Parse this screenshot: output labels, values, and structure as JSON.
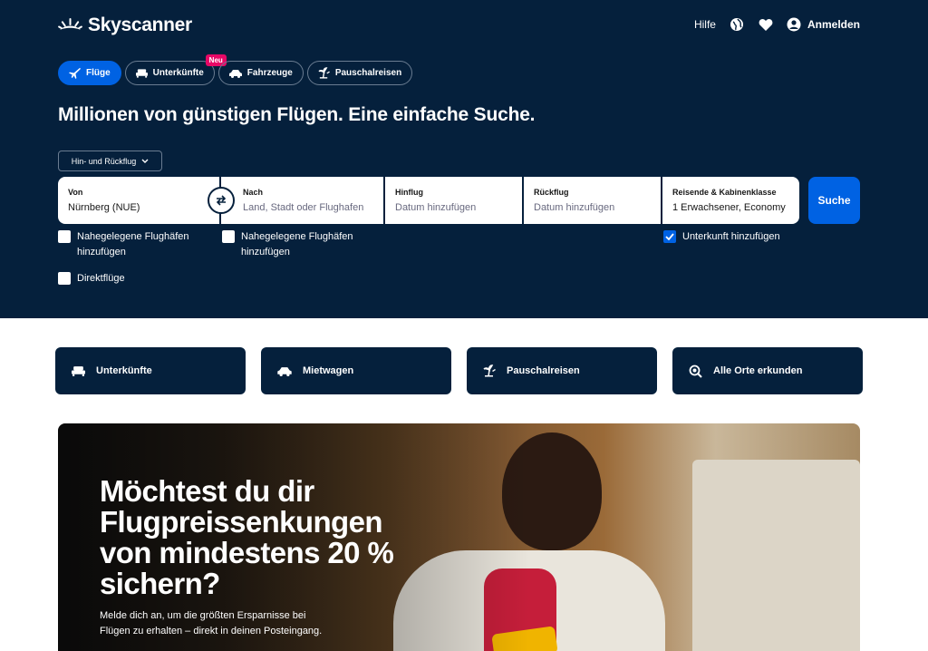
{
  "header": {
    "logo_text": "Skyscanner",
    "help_label": "Hilfe",
    "login_label": "Anmelden"
  },
  "tabs": [
    {
      "label": "Flüge",
      "icon": "plane-icon",
      "active": true
    },
    {
      "label": "Unterkünfte",
      "icon": "bed-icon",
      "badge": "Neu"
    },
    {
      "label": "Fahrzeuge",
      "icon": "car-icon"
    },
    {
      "label": "Pauschalreisen",
      "icon": "palm-plane-icon"
    }
  ],
  "headline": "Millionen von günstigen Flügen. Eine einfache Suche.",
  "trip_type": "Hin- und Rückflug",
  "search": {
    "from_label": "Von",
    "from_value": "Nürnberg (NUE)",
    "to_label": "Nach",
    "to_placeholder": "Land, Stadt oder Flughafen",
    "depart_label": "Hinflug",
    "depart_placeholder": "Datum hinzufügen",
    "return_label": "Rückflug",
    "return_placeholder": "Datum hinzufügen",
    "pax_label": "Reisende & Kabinenklasse",
    "pax_value": "1 Erwachsener, Economy",
    "search_button": "Suche"
  },
  "checkboxes": {
    "nearby_from": "Nahegelegene Flughäfen hinzufügen",
    "nearby_to": "Nahegelegene Flughäfen hinzufügen",
    "direct": "Direktflüge",
    "add_hotel": "Unterkunft hinzufügen"
  },
  "quicklinks": [
    {
      "label": "Unterkünfte",
      "icon": "bed-icon"
    },
    {
      "label": "Mietwagen",
      "icon": "car-icon"
    },
    {
      "label": "Pauschalreisen",
      "icon": "palm-plane-icon"
    },
    {
      "label": "Alle Orte erkunden",
      "icon": "explore-icon"
    }
  ],
  "banner": {
    "title": "Möchtest du dir Flugpreissenkungen von mindestens 20 % sichern?",
    "subtitle": "Melde dich an, um die größten Ersparnisse bei Flügen zu erhalten – direkt in deinen Posteingang."
  },
  "colors": {
    "navy": "#05203c",
    "primary_blue": "#0062e3",
    "badge_pink": "#e70866"
  }
}
